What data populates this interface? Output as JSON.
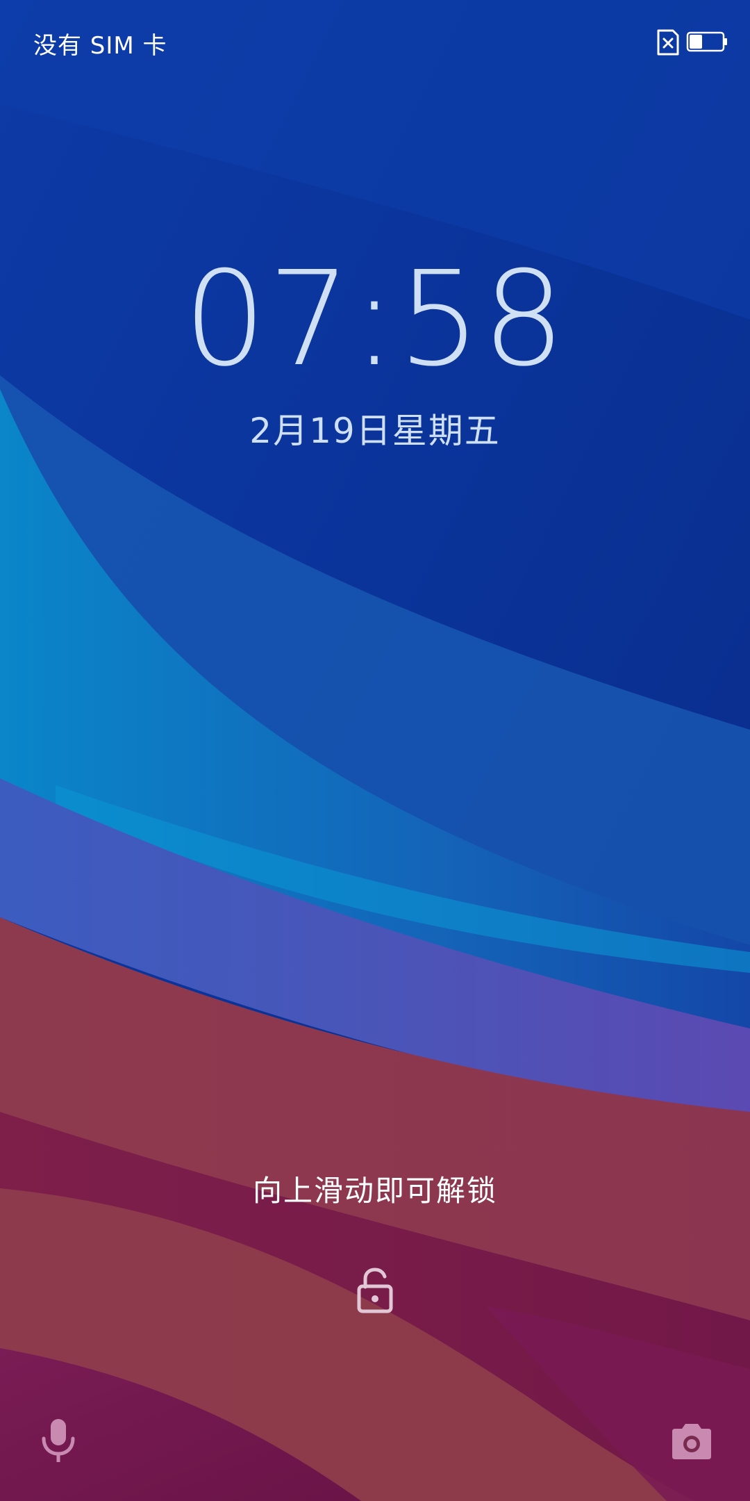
{
  "status_bar": {
    "carrier_text": "没有 SIM 卡",
    "sim_status_icon": "no-sim-icon",
    "battery_icon": "battery-icon",
    "battery_level": 0.4
  },
  "lockscreen": {
    "time": "07:58",
    "date": "2月19日星期五",
    "unlock_hint": "向上滑动即可解锁",
    "lock_icon": "unlock-padlock-icon"
  },
  "shortcuts": {
    "left_icon": "microphone-icon",
    "right_icon": "camera-icon"
  },
  "colors": {
    "wallpaper_top": "#0b2f93",
    "wallpaper_mid": "#0a8ccc",
    "wallpaper_purple": "#5a4fb0",
    "wallpaper_red": "#8b2f4f",
    "wallpaper_magenta": "#7a1a55",
    "clock_text": "#cfe0f4",
    "icon_muted": "#d9a9c4"
  }
}
